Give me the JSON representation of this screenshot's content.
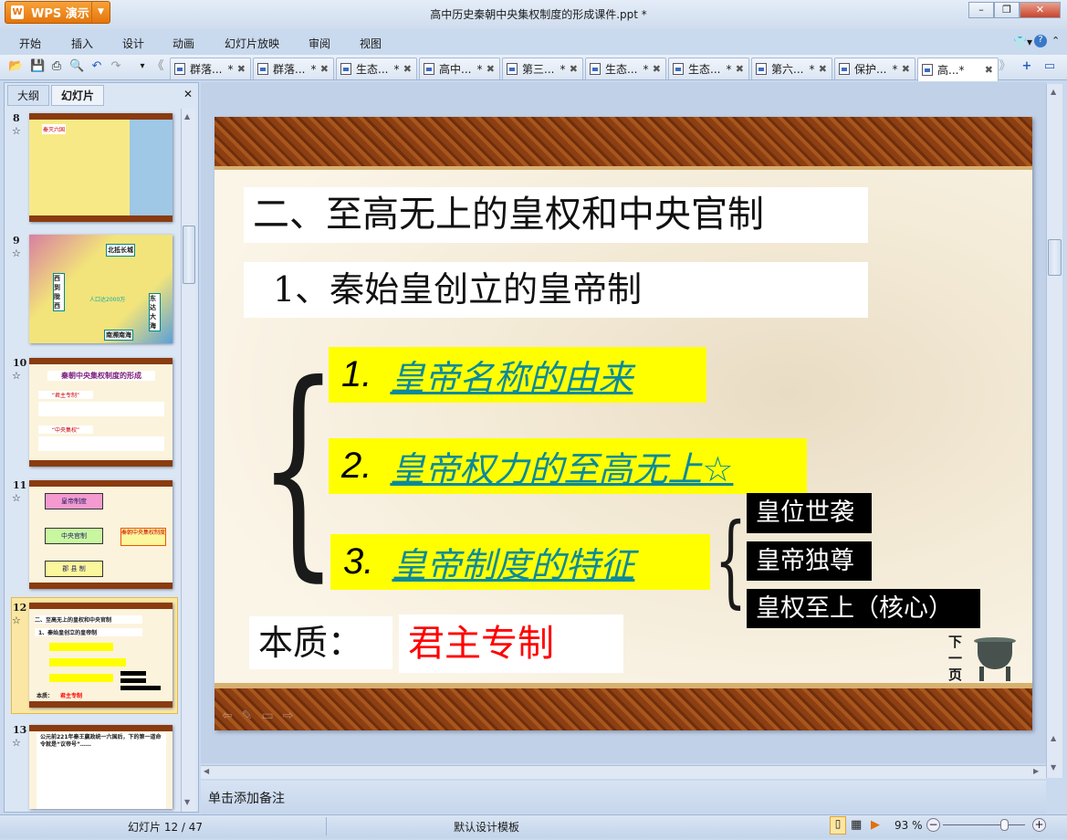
{
  "app": {
    "name": "WPS 演示",
    "title": "高中历史秦朝中央集权制度的形成课件.ppt *"
  },
  "window": {
    "minimize": "–",
    "restore": "❐",
    "close": "✕"
  },
  "menu": [
    "开始",
    "插入",
    "设计",
    "动画",
    "幻灯片放映",
    "审阅",
    "视图"
  ],
  "tabs": [
    {
      "label": "群落...",
      "mod": "*"
    },
    {
      "label": "群落...",
      "mod": "*"
    },
    {
      "label": "生态...",
      "mod": "*"
    },
    {
      "label": "高中...",
      "mod": "*"
    },
    {
      "label": "第三...",
      "mod": "*"
    },
    {
      "label": "生态...",
      "mod": "*"
    },
    {
      "label": "生态...",
      "mod": "*"
    },
    {
      "label": "第六...",
      "mod": "*"
    },
    {
      "label": "保护...",
      "mod": "*"
    },
    {
      "label": "高...*",
      "mod": "",
      "active": true
    }
  ],
  "panel": {
    "tab_outline": "大纲",
    "tab_slides": "幻灯片",
    "close": "✕"
  },
  "thumbnails": [
    {
      "num": "8",
      "title": "秦灭六国"
    },
    {
      "num": "9",
      "labels": [
        "北抵长城",
        "西到陇西",
        "人口达2000万",
        "东达大海",
        "南濒南海"
      ]
    },
    {
      "num": "10",
      "title": "秦朝中央集权制度的形成",
      "items": [
        "“君主专制”",
        "“中央集权”"
      ]
    },
    {
      "num": "11",
      "items": [
        "皇帝制度",
        "中央官制",
        "郡 县 制",
        "秦朝中央集权制度"
      ]
    },
    {
      "num": "12",
      "selected": true
    },
    {
      "num": "13",
      "text": "公元前221年秦王嬴政统一六国后，下的第一道命令就是“议帝号”……"
    }
  ],
  "slide": {
    "heading": "二、至高无上的皇权和中央官制",
    "subheading": "1、秦始皇创立的皇帝制",
    "points": [
      {
        "num": "1.",
        "text": "皇帝名称的由来"
      },
      {
        "num": "2.",
        "text": "皇帝权力的至高无上☆"
      },
      {
        "num": "3.",
        "text": "皇帝制度的特征"
      }
    ],
    "features": [
      "皇位世袭",
      "皇帝独尊",
      "皇权至上（核心）"
    ],
    "essence_label": "本质：",
    "essence_value": "君主专制",
    "next_page": "下一页"
  },
  "notes": {
    "placeholder": "单击添加备注"
  },
  "status": {
    "slide_counter": "幻灯片 12 / 47",
    "template": "默认设计模板",
    "zoom": "93 %",
    "zoom_level": 93
  }
}
